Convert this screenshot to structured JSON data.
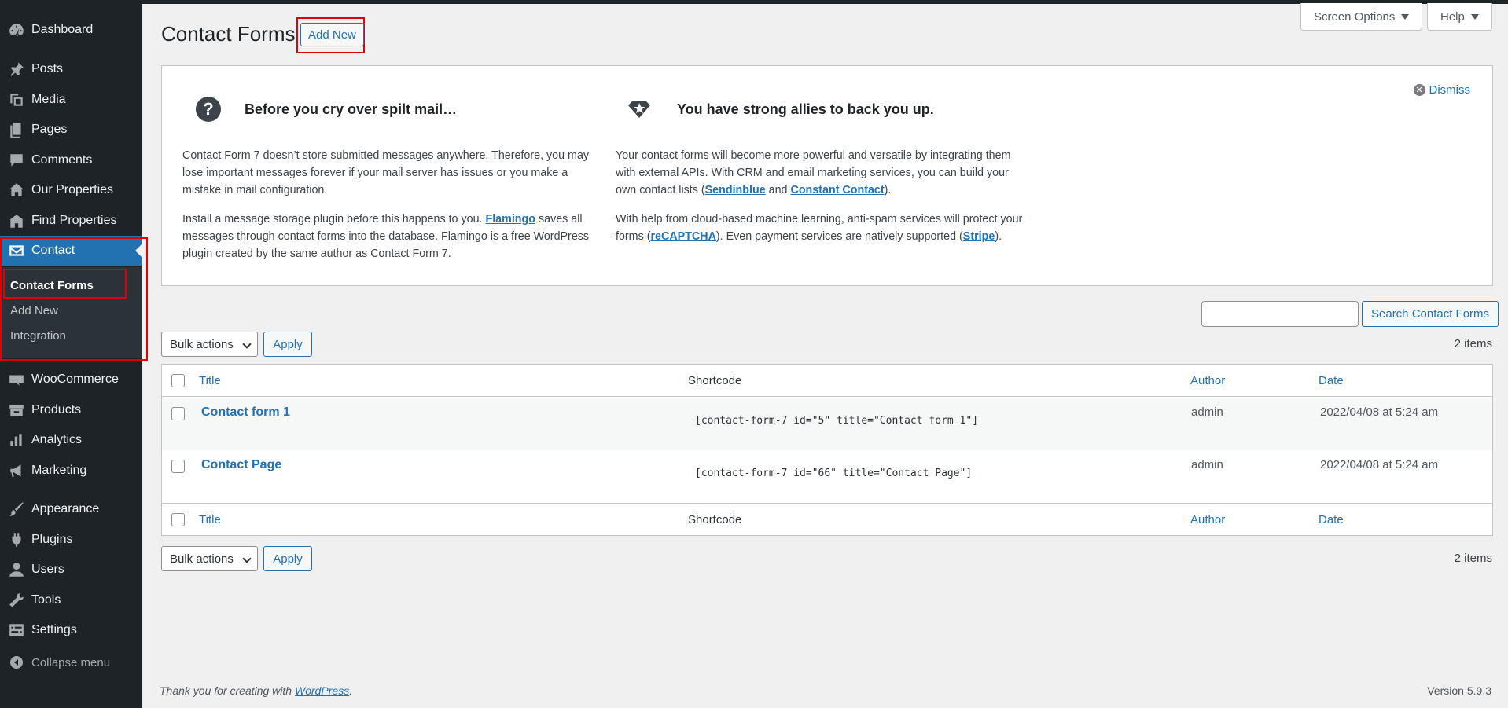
{
  "sidebar": {
    "items": [
      {
        "label": "Dashboard",
        "icon": "dashboard-icon"
      },
      {
        "label": "Posts",
        "icon": "pin-icon"
      },
      {
        "label": "Media",
        "icon": "media-icon"
      },
      {
        "label": "Pages",
        "icon": "pages-icon"
      },
      {
        "label": "Comments",
        "icon": "comment-icon"
      },
      {
        "label": "Our Properties",
        "icon": "home-icon"
      },
      {
        "label": "Find Properties",
        "icon": "building-icon"
      },
      {
        "label": "Contact",
        "icon": "mail-icon"
      },
      {
        "label": "WooCommerce",
        "icon": "woo-icon"
      },
      {
        "label": "Products",
        "icon": "archive-icon"
      },
      {
        "label": "Analytics",
        "icon": "bar-chart-icon"
      },
      {
        "label": "Marketing",
        "icon": "megaphone-icon"
      },
      {
        "label": "Appearance",
        "icon": "brush-icon"
      },
      {
        "label": "Plugins",
        "icon": "plug-icon"
      },
      {
        "label": "Users",
        "icon": "user-icon"
      },
      {
        "label": "Tools",
        "icon": "wrench-icon"
      },
      {
        "label": "Settings",
        "icon": "settings-icon"
      }
    ],
    "submenu": [
      "Contact Forms",
      "Add New",
      "Integration"
    ],
    "collapse_label": "Collapse menu"
  },
  "header": {
    "title": "Contact Forms",
    "add_new": "Add New",
    "screen_options": "Screen Options",
    "help": "Help"
  },
  "welcome": {
    "dismiss": "Dismiss",
    "left": {
      "heading": "Before you cry over spilt mail…",
      "p1": "Contact Form 7 doesn’t store submitted messages anywhere. Therefore, you may lose important messages forever if your mail server has issues or you make a mistake in mail configuration.",
      "p2_before": "Install a message storage plugin before this happens to you. ",
      "p2_link": "Flamingo",
      "p2_after": " saves all messages through contact forms into the database. Flamingo is a free WordPress plugin created by the same author as Contact Form 7."
    },
    "right": {
      "heading": "You have strong allies to back you up.",
      "p1_before": "Your contact forms will become more powerful and versatile by integrating them with external APIs. With CRM and email marketing services, you can build your own contact lists (",
      "p1_link1": "Sendinblue",
      "p1_mid": " and ",
      "p1_link2": "Constant Contact",
      "p1_after": ").",
      "p2_before": "With help from cloud-based machine learning, anti-spam services will protect your forms (",
      "p2_link1": "reCAPTCHA",
      "p2_mid": "). Even payment services are natively supported (",
      "p2_link2": "Stripe",
      "p2_after": ")."
    }
  },
  "search": {
    "button": "Search Contact Forms",
    "value": ""
  },
  "bulk": {
    "label": "Bulk actions",
    "apply": "Apply",
    "count": "2 items"
  },
  "table": {
    "columns": [
      "Title",
      "Shortcode",
      "Author",
      "Date"
    ],
    "rows": [
      {
        "title": "Contact form 1",
        "shortcode": "[contact-form-7 id=\"5\" title=\"Contact form 1\"]",
        "author": "admin",
        "date": "2022/04/08 at 5:24 am"
      },
      {
        "title": "Contact Page",
        "shortcode": "[contact-form-7 id=\"66\" title=\"Contact Page\"]",
        "author": "admin",
        "date": "2022/04/08 at 5:24 am"
      }
    ]
  },
  "footer": {
    "thanks_before": "Thank you for creating with ",
    "thanks_link": "WordPress",
    "thanks_after": ".",
    "version": "Version 5.9.3"
  }
}
